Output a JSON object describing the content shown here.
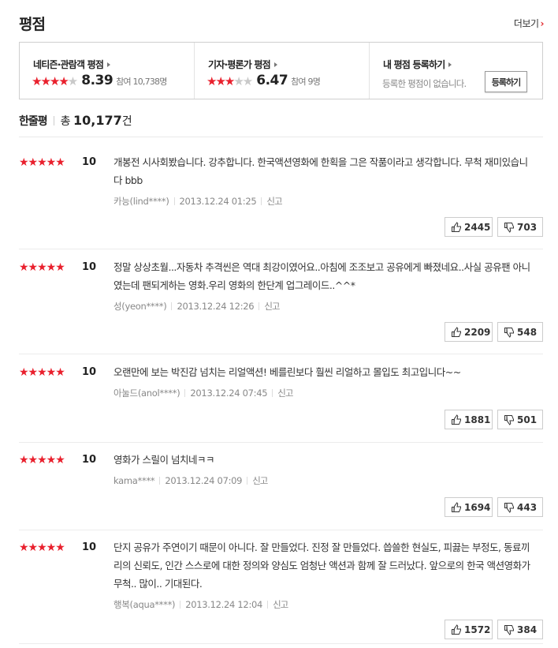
{
  "header": {
    "title": "평점",
    "more_label": "더보기",
    "more_chevron": "›"
  },
  "ratings": {
    "netizen": {
      "label": "네티즌·관람객 평점",
      "stars": "★★★★",
      "stars_off": "★",
      "score": "8.39",
      "participants": "참여 10,738명"
    },
    "critic": {
      "label": "기자·평론가 평점",
      "stars": "★★★",
      "stars_off": "★★",
      "score": "6.47",
      "participants": "참여 9명"
    },
    "mine": {
      "label": "내 평점 등록하기",
      "empty_text": "등록한 평점이 없습니다.",
      "button_label": "등록하기"
    }
  },
  "summary": {
    "label": "한줄평",
    "total_prefix": "총",
    "total_count": "10,177",
    "total_suffix": "건"
  },
  "reviews": [
    {
      "stars": "★★★★★",
      "score": "10",
      "text": "개봉전 시사회봤습니다. 강추합니다. 한국액션영화에 한획을 그은 작품이라고 생각합니다. 무척 재미있습니다 bbb",
      "author": "카능(lind****)",
      "date": "2013.12.24 01:25",
      "report": "신고",
      "likes": "2445",
      "dislikes": "703"
    },
    {
      "stars": "★★★★★",
      "score": "10",
      "text": "정말 상상초월...자동차 추격씬은 역대 최강이였어요..아침에 조조보고 공유에게 빠졌네요..사실 공유팬 아니였는데 팬되게하는 영화.우리 영화의 한단계 업그레이드..^^*",
      "author": "성(yeon****)",
      "date": "2013.12.24 12:26",
      "report": "신고",
      "likes": "2209",
      "dislikes": "548"
    },
    {
      "stars": "★★★★★",
      "score": "10",
      "text": "오랜만에 보는 박진감 넘치는 리얼액션! 베를린보다 훨씬 리얼하고 몰입도 최고입니다~~",
      "author": "아눌드(anol****)",
      "date": "2013.12.24 07:45",
      "report": "신고",
      "likes": "1881",
      "dislikes": "501"
    },
    {
      "stars": "★★★★★",
      "score": "10",
      "text": "영화가 스릴이 넘치네ㅋㅋ",
      "author": "kama****",
      "date": "2013.12.24 07:09",
      "report": "신고",
      "likes": "1694",
      "dislikes": "443"
    },
    {
      "stars": "★★★★★",
      "score": "10",
      "text": "단지 공유가 주연이기 때문이 아니다. 잘 만들었다. 진정 잘 만들었다. 씁쓸한 현실도, 피끓는 부정도, 동료끼리의 신뢰도, 인간 스스로에 대한 정의와 양심도 엄청난 액션과 함께 잘 드러났다. 앞으로의 한국 액션영화가 무척.. 많이.. 기대된다.",
      "author": "행복(aqua****)",
      "date": "2013.12.24 12:04",
      "report": "신고",
      "likes": "1572",
      "dislikes": "384"
    }
  ],
  "colors": {
    "star_on": "#e9202d",
    "star_off": "#c9c9c9",
    "accent": "#e0262b"
  },
  "icons": {
    "like": "thumbs-up-icon",
    "dislike": "thumbs-down-icon",
    "arrow": "triangle-right-icon"
  }
}
